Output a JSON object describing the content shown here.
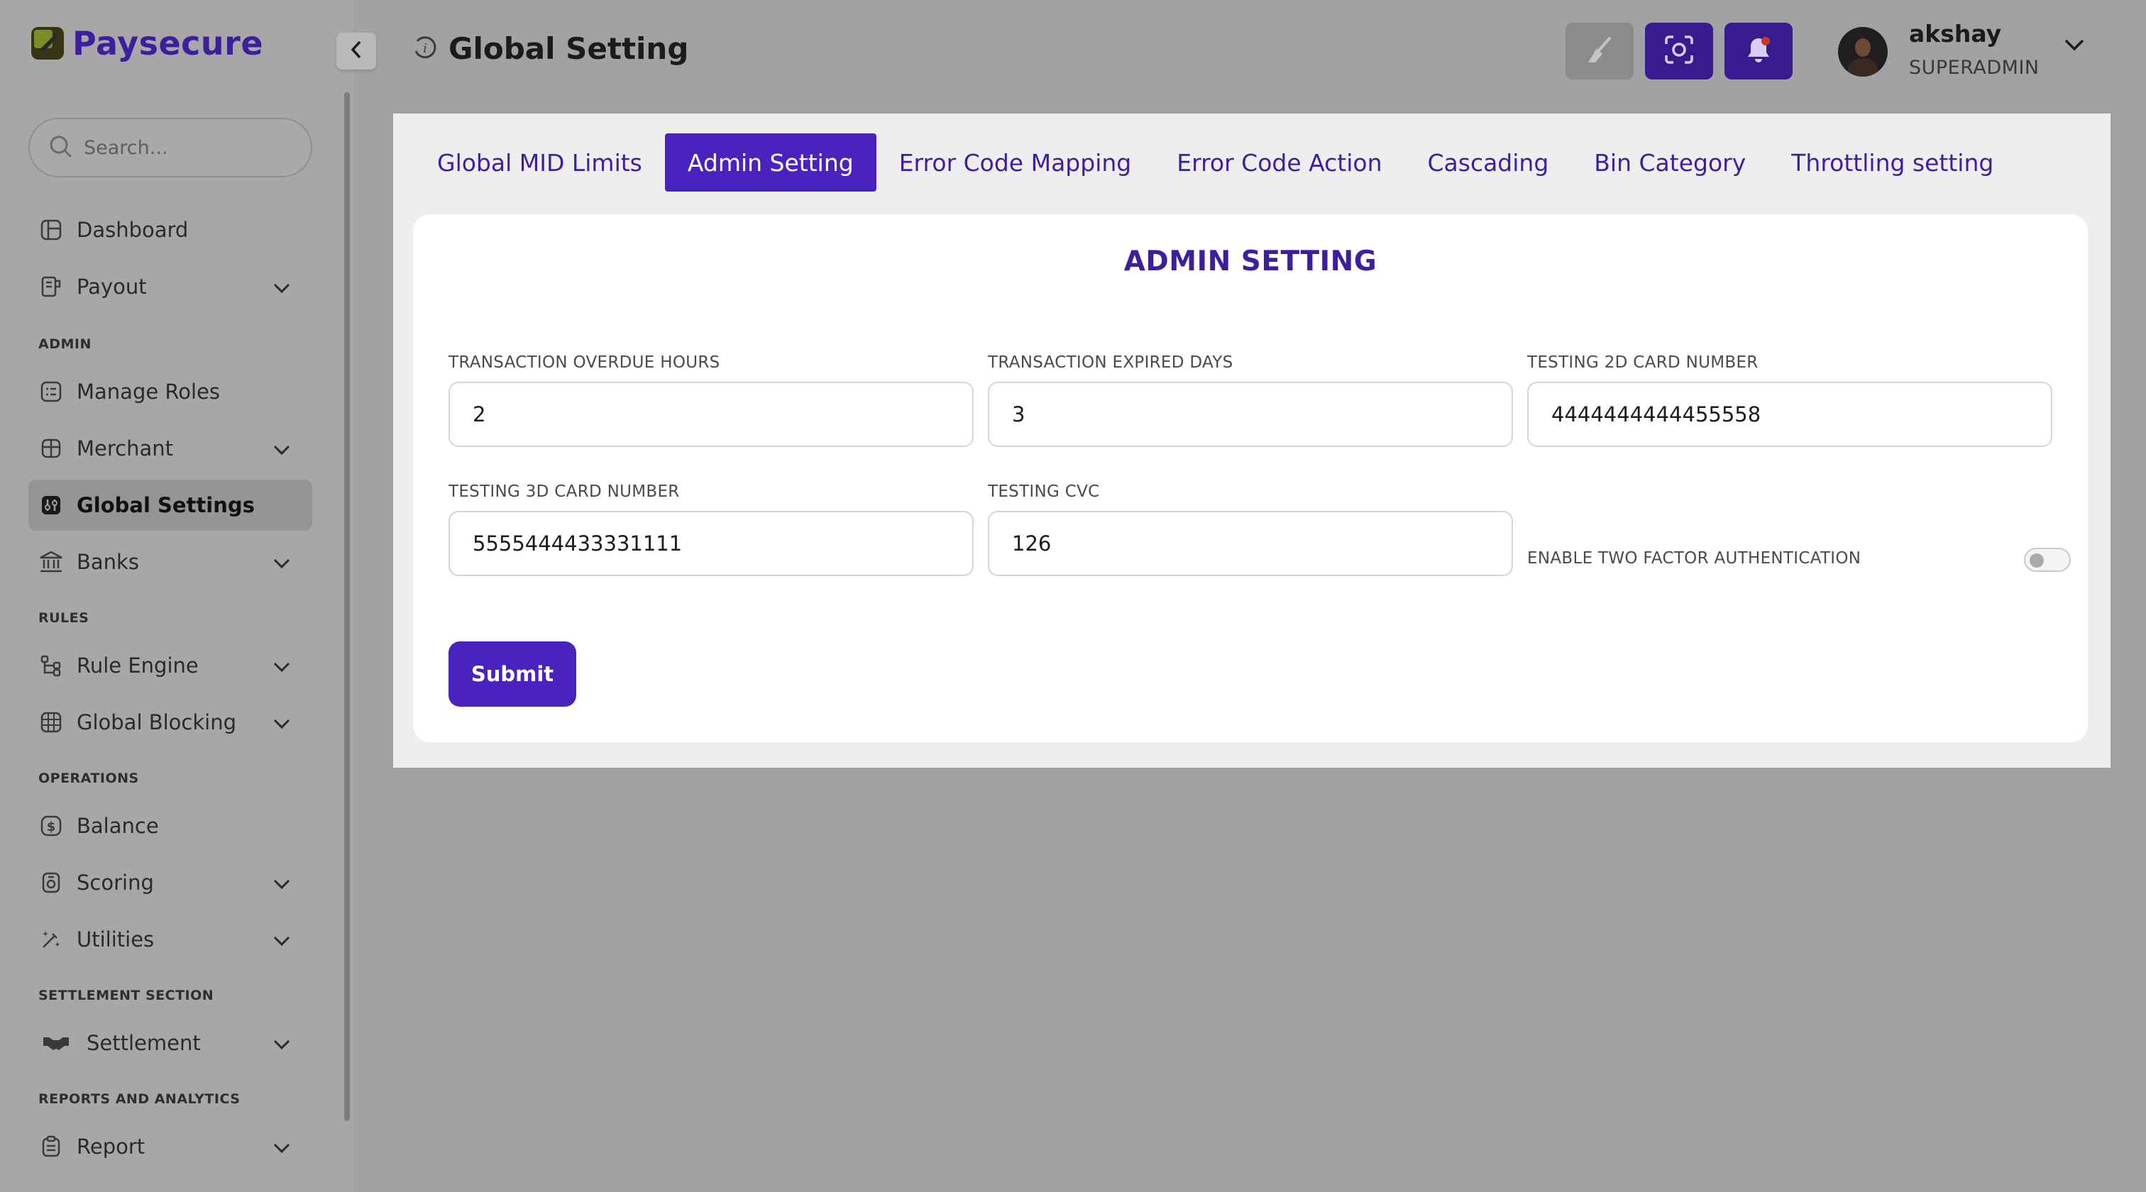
{
  "brand": {
    "name": "Paysecure"
  },
  "search": {
    "placeholder": "Search..."
  },
  "sidebar": {
    "items": [
      {
        "label": "Dashboard"
      },
      {
        "label": "Payout"
      },
      {
        "label": "Manage Roles"
      },
      {
        "label": "Merchant"
      },
      {
        "label": "Global Settings"
      },
      {
        "label": "Banks"
      },
      {
        "label": "Rule Engine"
      },
      {
        "label": "Global Blocking"
      },
      {
        "label": "Balance"
      },
      {
        "label": "Scoring"
      },
      {
        "label": "Utilities"
      },
      {
        "label": "Settlement"
      },
      {
        "label": "Report"
      }
    ],
    "sections": {
      "admin": "ADMIN",
      "rules": "RULES",
      "operations": "OPERATIONS",
      "settlement": "SETTLEMENT SECTION",
      "reports": "REPORTS AND ANALYTICS"
    }
  },
  "header": {
    "title": "Global Setting",
    "info_glyph": "i"
  },
  "user": {
    "name": "akshay",
    "role": "SUPERADMIN"
  },
  "tabs": [
    {
      "label": "Global MID Limits"
    },
    {
      "label": "Admin Setting"
    },
    {
      "label": "Error Code Mapping"
    },
    {
      "label": "Error Code Action"
    },
    {
      "label": "Cascading"
    },
    {
      "label": "Bin Category"
    },
    {
      "label": "Throttling setting"
    }
  ],
  "form": {
    "title": "ADMIN SETTING",
    "fields": {
      "overdue_hours": {
        "label": "TRANSACTION OVERDUE HOURS",
        "value": "2"
      },
      "expired_days": {
        "label": "TRANSACTION EXPIRED DAYS",
        "value": "3"
      },
      "card_2d": {
        "label": "TESTING 2D CARD NUMBER",
        "value": "4444444444455558"
      },
      "card_3d": {
        "label": "TESTING 3D CARD NUMBER",
        "value": "5555444433331111"
      },
      "cvc": {
        "label": "TESTING CVC",
        "value": "126"
      }
    },
    "two_factor": {
      "label": "ENABLE TWO FACTOR AUTHENTICATION",
      "enabled": false
    },
    "submit_label": "Submit"
  },
  "colors": {
    "brand_purple": "#4a22c0",
    "brand_purple_dark": "#3a1a8f",
    "title_purple": "#3d1f9e"
  }
}
